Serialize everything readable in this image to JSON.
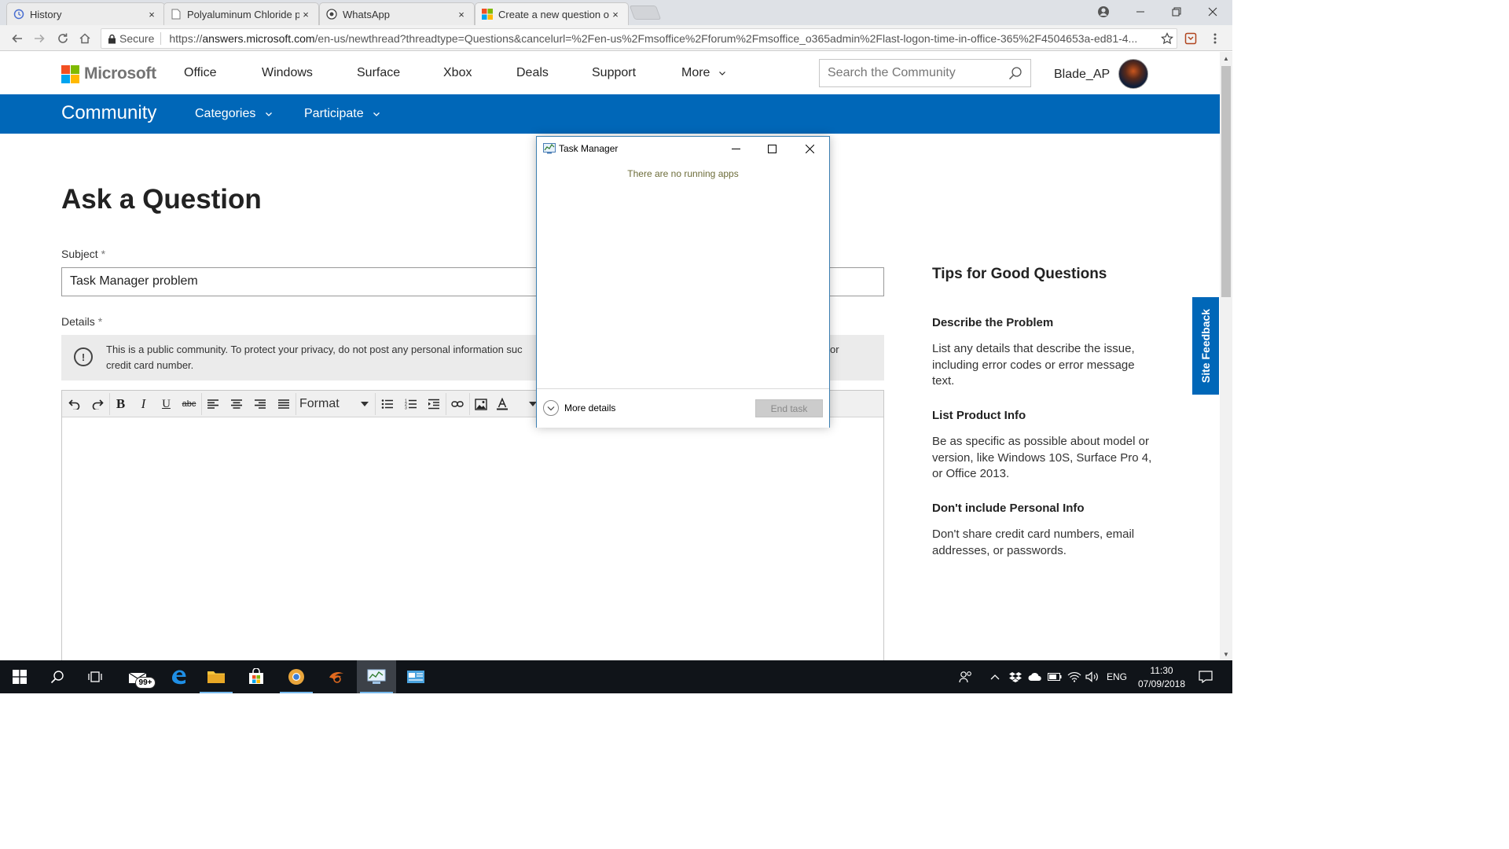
{
  "browser": {
    "tabs": [
      {
        "title": "History",
        "icon": "history-icon"
      },
      {
        "title": "Polyaluminum Chloride p",
        "icon": "page-icon"
      },
      {
        "title": "WhatsApp",
        "icon": "whatsapp-icon"
      },
      {
        "title": "Create a new question or",
        "icon": "microsoft-icon",
        "active": true
      }
    ],
    "tab_close": "×",
    "secure_label": "Secure",
    "url_scheme": "https://",
    "url_host": "answers.microsoft.com",
    "url_rest": "/en-us/newthread?threadtype=Questions&cancelurl=%2Fen-us%2Fmsoffice%2Fforum%2Fmsoffice_o365admin%2Flast-logon-time-in-office-365%2F4504653a-ed81-4..."
  },
  "header": {
    "brand": "Microsoft",
    "nav": [
      "Office",
      "Windows",
      "Surface",
      "Xbox",
      "Deals",
      "Support",
      "More"
    ],
    "search_placeholder": "Search the Community",
    "username": "Blade_AP"
  },
  "community_bar": {
    "title": "Community",
    "categories": "Categories",
    "participate": "Participate"
  },
  "form": {
    "page_title": "Ask a Question",
    "subject_label": "Subject",
    "required_mark": "*",
    "subject_value": "Task Manager problem",
    "details_label": "Details",
    "notice_line1": "This is a public community. To protect your privacy, do not post any personal information suc",
    "notice_tail": "or",
    "notice_line2": "credit card number.",
    "format_select": "Format"
  },
  "tips": {
    "title": "Tips for Good Questions",
    "sections": [
      {
        "heading": "Describe the Problem",
        "lines": [
          "List any details that describe the issue,",
          "including error codes or error message",
          "text."
        ]
      },
      {
        "heading": "List Product Info",
        "lines": [
          "Be as specific as possible about model or",
          "version, like Windows 10S, Surface Pro 4,",
          "or Office 2013."
        ]
      },
      {
        "heading": "Don't include Personal Info",
        "lines": [
          "Don't share credit card numbers, email",
          "addresses, or passwords."
        ]
      }
    ]
  },
  "site_feedback": "Site Feedback",
  "task_manager": {
    "title": "Task Manager",
    "empty_message": "There are no running apps",
    "more_details": "More details",
    "end_task": "End task"
  },
  "taskbar": {
    "mail_badge": "99+",
    "language": "ENG",
    "time": "11:30",
    "date": "07/09/2018"
  },
  "colors": {
    "community_blue": "#0067b8",
    "taskbar_bg": "#101419",
    "ms_red": "#f25022",
    "ms_green": "#7fba00",
    "ms_blue": "#00a4ef",
    "ms_yellow": "#ffb900"
  }
}
